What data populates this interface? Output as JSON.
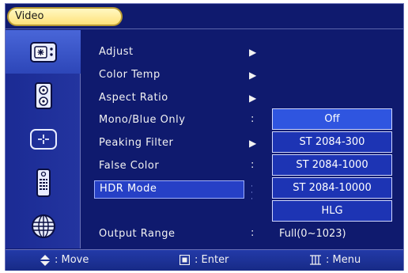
{
  "title": "Video",
  "sidebar": {
    "items": [
      {
        "icon": "display-settings-icon",
        "active": true
      },
      {
        "icon": "speaker-icon",
        "active": false
      },
      {
        "icon": "crosshair-icon",
        "active": false
      },
      {
        "icon": "remote-control-icon",
        "active": false
      },
      {
        "icon": "globe-icon",
        "active": false
      }
    ]
  },
  "menu": {
    "items": [
      {
        "label": "Adjust",
        "indicator": "▶"
      },
      {
        "label": "Color Temp",
        "indicator": "▶"
      },
      {
        "label": "Aspect Ratio",
        "indicator": "▶"
      },
      {
        "label": "Mono/Blue Only",
        "indicator": ":"
      },
      {
        "label": "Peaking Filter",
        "indicator": "▶"
      },
      {
        "label": "False Color",
        "indicator": ":"
      },
      {
        "label": "HDR Mode",
        "indicator": ""
      },
      {
        "label": "Output Range",
        "indicator": ":"
      }
    ],
    "output_range_value": "Full(0~1023)"
  },
  "hdr_dropdown": {
    "options": [
      "Off",
      "ST 2084-300",
      "ST 2084-1000",
      "ST 2084-10000",
      "HLG"
    ],
    "selected": "Off"
  },
  "footer": {
    "move": ": Move",
    "enter": ": Enter",
    "menu": ": Menu"
  },
  "colors": {
    "background": "#0f1a6e",
    "highlight": "#2640c6",
    "title_pill": "#ffe27a"
  }
}
